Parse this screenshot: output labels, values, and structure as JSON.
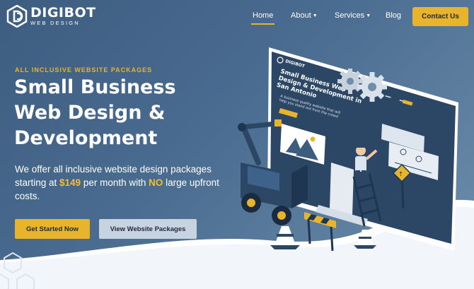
{
  "brand": {
    "name": "DIGIBOT",
    "tagline": "WEB DESIGN",
    "logo_icon": "db-hexagon-icon",
    "accent_color": "#e8b42b"
  },
  "nav": {
    "items": [
      {
        "label": "Home",
        "active": true
      },
      {
        "label": "About",
        "dropdown": true
      },
      {
        "label": "Services",
        "dropdown": true
      },
      {
        "label": "Blog"
      }
    ],
    "cta": "Contact Us"
  },
  "hero": {
    "eyebrow": "ALL INCLUSIVE WEBSITE PACKAGES",
    "headline": "Small Business Web Design & Development",
    "subtext_1": "We offer all inclusive website design packages starting at ",
    "price": "$149",
    "subtext_2": " per month with ",
    "no": "NO",
    "subtext_3": " large upfront costs.",
    "primary_button": "Get Started Now",
    "secondary_button": "View Website Packages"
  },
  "illustration": {
    "screen_logo": "DIGIBOT",
    "screen_heading": "Small Business Web Design & Development in San Antonio",
    "screen_subheading": "A business quality website that will help you stand out from the crowd",
    "icons": [
      "gear-icon",
      "crane-icon",
      "traffic-cone-icon",
      "barrier-icon",
      "ladder-icon",
      "sign-icon"
    ]
  }
}
